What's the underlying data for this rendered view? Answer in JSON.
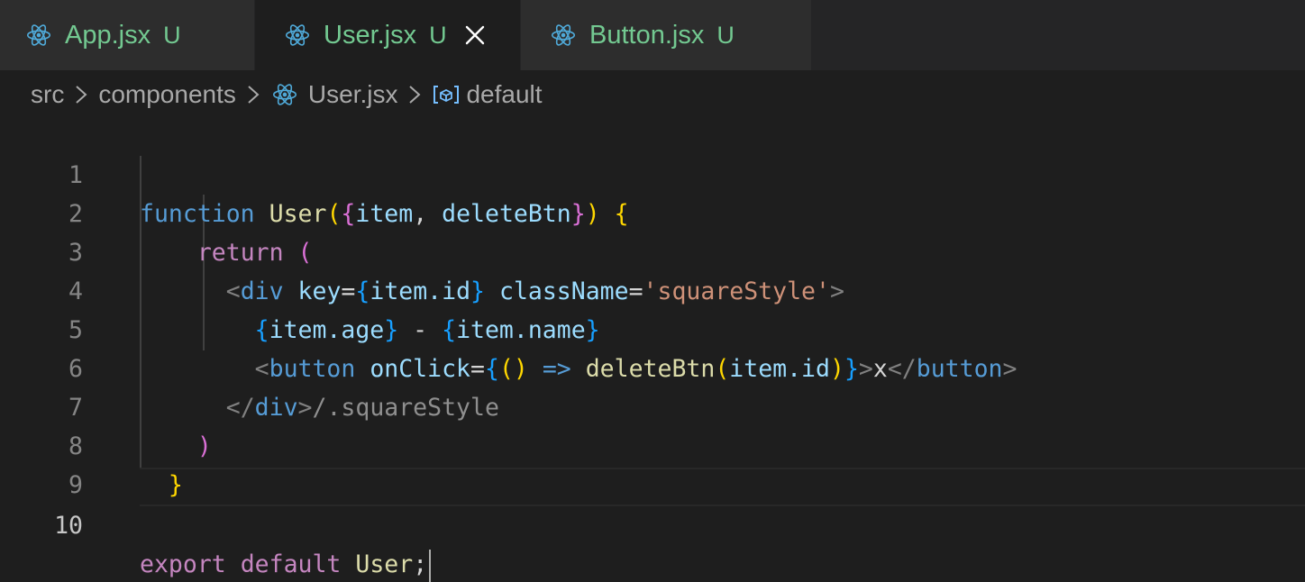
{
  "tabs": [
    {
      "label": "App.jsx",
      "status": "U",
      "icon": "react-icon",
      "active": false
    },
    {
      "label": "User.jsx",
      "status": "U",
      "icon": "react-icon",
      "active": true,
      "close": "×"
    },
    {
      "label": "Button.jsx",
      "status": "U",
      "icon": "react-icon",
      "active": false
    }
  ],
  "breadcrumb": {
    "items": [
      "src",
      "components",
      "User.jsx",
      "default"
    ],
    "separator": ">"
  },
  "editor": {
    "line_numbers": [
      "1",
      "2",
      "3",
      "4",
      "5",
      "6",
      "7",
      "8",
      "9",
      "10"
    ],
    "current_line": "10",
    "tokens": {
      "l1_function": "function",
      "l1_name": "User",
      "l1_paren_open": "(",
      "l1_brace_open": "{",
      "l1_item": "item",
      "l1_comma": ", ",
      "l1_deleteBtn": "deleteBtn",
      "l1_brace_close": "}",
      "l1_paren_close": ")",
      "l1_body_open": "{",
      "l2_return": "return",
      "l2_paren": "(",
      "l3_lt": "<",
      "l3_div": "div",
      "l3_key": "key",
      "l3_eq": "=",
      "l3_brace_open": "{",
      "l3_item_id": "item.id",
      "l3_brace_close": "}",
      "l3_className": "className",
      "l3_eq2": "=",
      "l3_str": "'squareStyle'",
      "l3_gt": ">",
      "l4_brace_open": "{",
      "l4_age": "item.age",
      "l4_brace_close": "}",
      "l4_dash": " - ",
      "l4_brace_open2": "{",
      "l4_name": "item.name",
      "l4_brace_close2": "}",
      "l5_lt": "<",
      "l5_button": "button",
      "l5_onClick": "onClick",
      "l5_eq": "=",
      "l5_brace_open": "{",
      "l5_parens": "()",
      "l5_arrow": "=>",
      "l5_deleteBtn": "deleteBtn",
      "l5_paren_open": "(",
      "l5_item_id": "item.id",
      "l5_paren_close": ")",
      "l5_brace_close": "}",
      "l5_gt": ">",
      "l5_x": "x",
      "l5_close_lt": "</",
      "l5_close_button": "button",
      "l5_close_gt": ">",
      "l6_close_lt": "</",
      "l6_div": "div",
      "l6_gt": ">",
      "l6_hint": "/.squareStyle",
      "l7_paren": ")",
      "l8_brace": "}",
      "l10_export": "export",
      "l10_default": "default",
      "l10_user": "User",
      "l10_semi": ";"
    }
  },
  "colors": {
    "tab_label_untracked": "#73c991",
    "keyword": "#569cd6",
    "control": "#c586c0",
    "function": "#dcdcaa",
    "variable": "#9cdcfe",
    "string": "#ce9178",
    "bracket_level1": "#ffd700",
    "bracket_level2": "#da70d6",
    "bracket_level3": "#179fff",
    "react_icon": "#4fa9d8"
  }
}
